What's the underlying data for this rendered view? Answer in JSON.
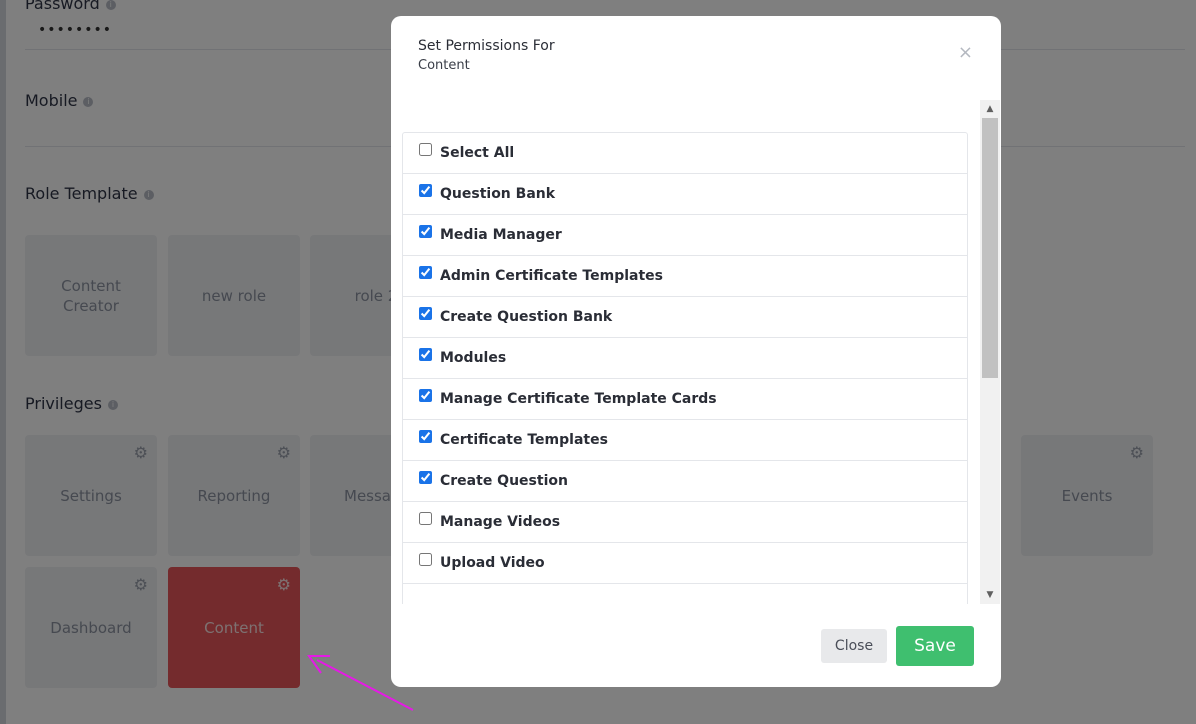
{
  "background": {
    "password_label": "Password",
    "password_value": "••••••••",
    "mobile_label": "Mobile",
    "role_template_label": "Role Template",
    "roles": [
      {
        "label": "Content Creator"
      },
      {
        "label": "new role"
      },
      {
        "label": "role 2"
      }
    ],
    "privileges_label": "Privileges",
    "privileges": [
      {
        "label": "Settings"
      },
      {
        "label": "Reporting"
      },
      {
        "label": "Messa"
      },
      {
        "label": "Events"
      },
      {
        "label": "Dashboard"
      },
      {
        "label": "Content"
      }
    ],
    "info_glyph": "i",
    "gear_glyph": "⚙"
  },
  "modal": {
    "title": "Set Permissions For",
    "subtitle": "Content",
    "close_glyph": "×",
    "permissions": [
      {
        "label": "Select All",
        "checked": false
      },
      {
        "label": "Question Bank",
        "checked": true
      },
      {
        "label": "Media Manager",
        "checked": true
      },
      {
        "label": "Admin Certificate Templates",
        "checked": true
      },
      {
        "label": "Create Question Bank",
        "checked": true
      },
      {
        "label": "Modules",
        "checked": true
      },
      {
        "label": "Manage Certificate Template Cards",
        "checked": true
      },
      {
        "label": "Certificate Templates",
        "checked": true
      },
      {
        "label": "Create Question",
        "checked": true
      },
      {
        "label": "Manage Videos",
        "checked": false
      },
      {
        "label": "Upload Video",
        "checked": false
      }
    ],
    "close_button": "Close",
    "save_button": "Save"
  },
  "colors": {
    "save_green": "#3fbf6f",
    "active_tile_red": "#e8565a",
    "annotation_arrow": "#e619e6"
  }
}
